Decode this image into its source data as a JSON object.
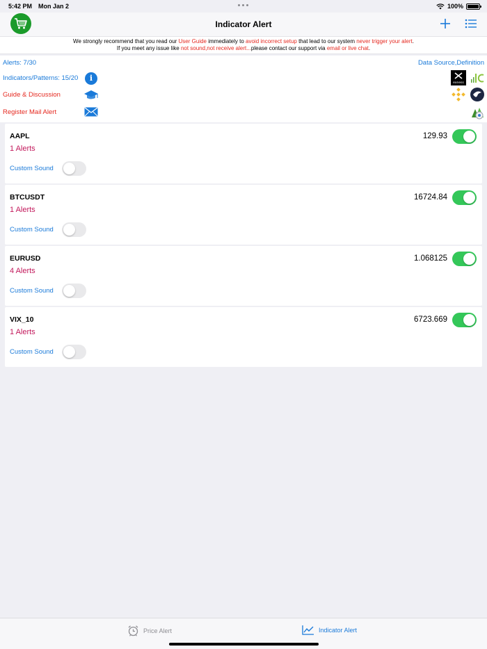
{
  "status_bar": {
    "time": "5:42 PM",
    "date": "Mon Jan 2",
    "battery": "100%"
  },
  "nav": {
    "title": "Indicator Alert",
    "cart_icon": "cart-icon",
    "add_icon": "plus-icon",
    "menu_icon": "list-icon"
  },
  "notice": {
    "line1_a": "We strongly recommend that you read our ",
    "line1_b": "User Guide",
    "line1_c": " immediately to ",
    "line1_d": "avoid incorrect setup",
    "line1_e": " that lead to our system ",
    "line1_f": "never trigger your alert",
    "line1_g": ".",
    "line2_a": "If you meet any issue like ",
    "line2_b": "not sound,not receive alert...",
    "line2_c": "please contact our support via ",
    "line2_d": "email or live chat",
    "line2_e": "."
  },
  "info": {
    "alerts": "Alerts: 7/30",
    "indicators": "Indicators/Patterns: 15/20",
    "guide": "Guide & Discussion",
    "register": "Register Mail Alert",
    "data_source": "Data Source,Definition",
    "broker_exness_label": "exness"
  },
  "cards": [
    {
      "symbol": "AAPL",
      "alerts": "1 Alerts",
      "price": "129.93",
      "sound_label": "Custom Sound"
    },
    {
      "symbol": "BTCUSDT",
      "alerts": "1 Alerts",
      "price": "16724.84",
      "sound_label": "Custom Sound"
    },
    {
      "symbol": "EURUSD",
      "alerts": "4 Alerts",
      "price": "1.068125",
      "sound_label": "Custom Sound"
    },
    {
      "symbol": "VIX_10",
      "alerts": "1 Alerts",
      "price": "6723.669",
      "sound_label": "Custom Sound"
    }
  ],
  "tabs": [
    {
      "label": "Price Alert",
      "icon": "alarm-clock-icon",
      "active": false
    },
    {
      "label": "Indicator Alert",
      "icon": "line-chart-icon",
      "active": true
    }
  ],
  "colors": {
    "accent": "#1a7ad9",
    "alert_red": "#e5281f",
    "alerts_count": "#c2185b",
    "toggle_on": "#34c759",
    "cart_green": "#1b9b2b"
  }
}
